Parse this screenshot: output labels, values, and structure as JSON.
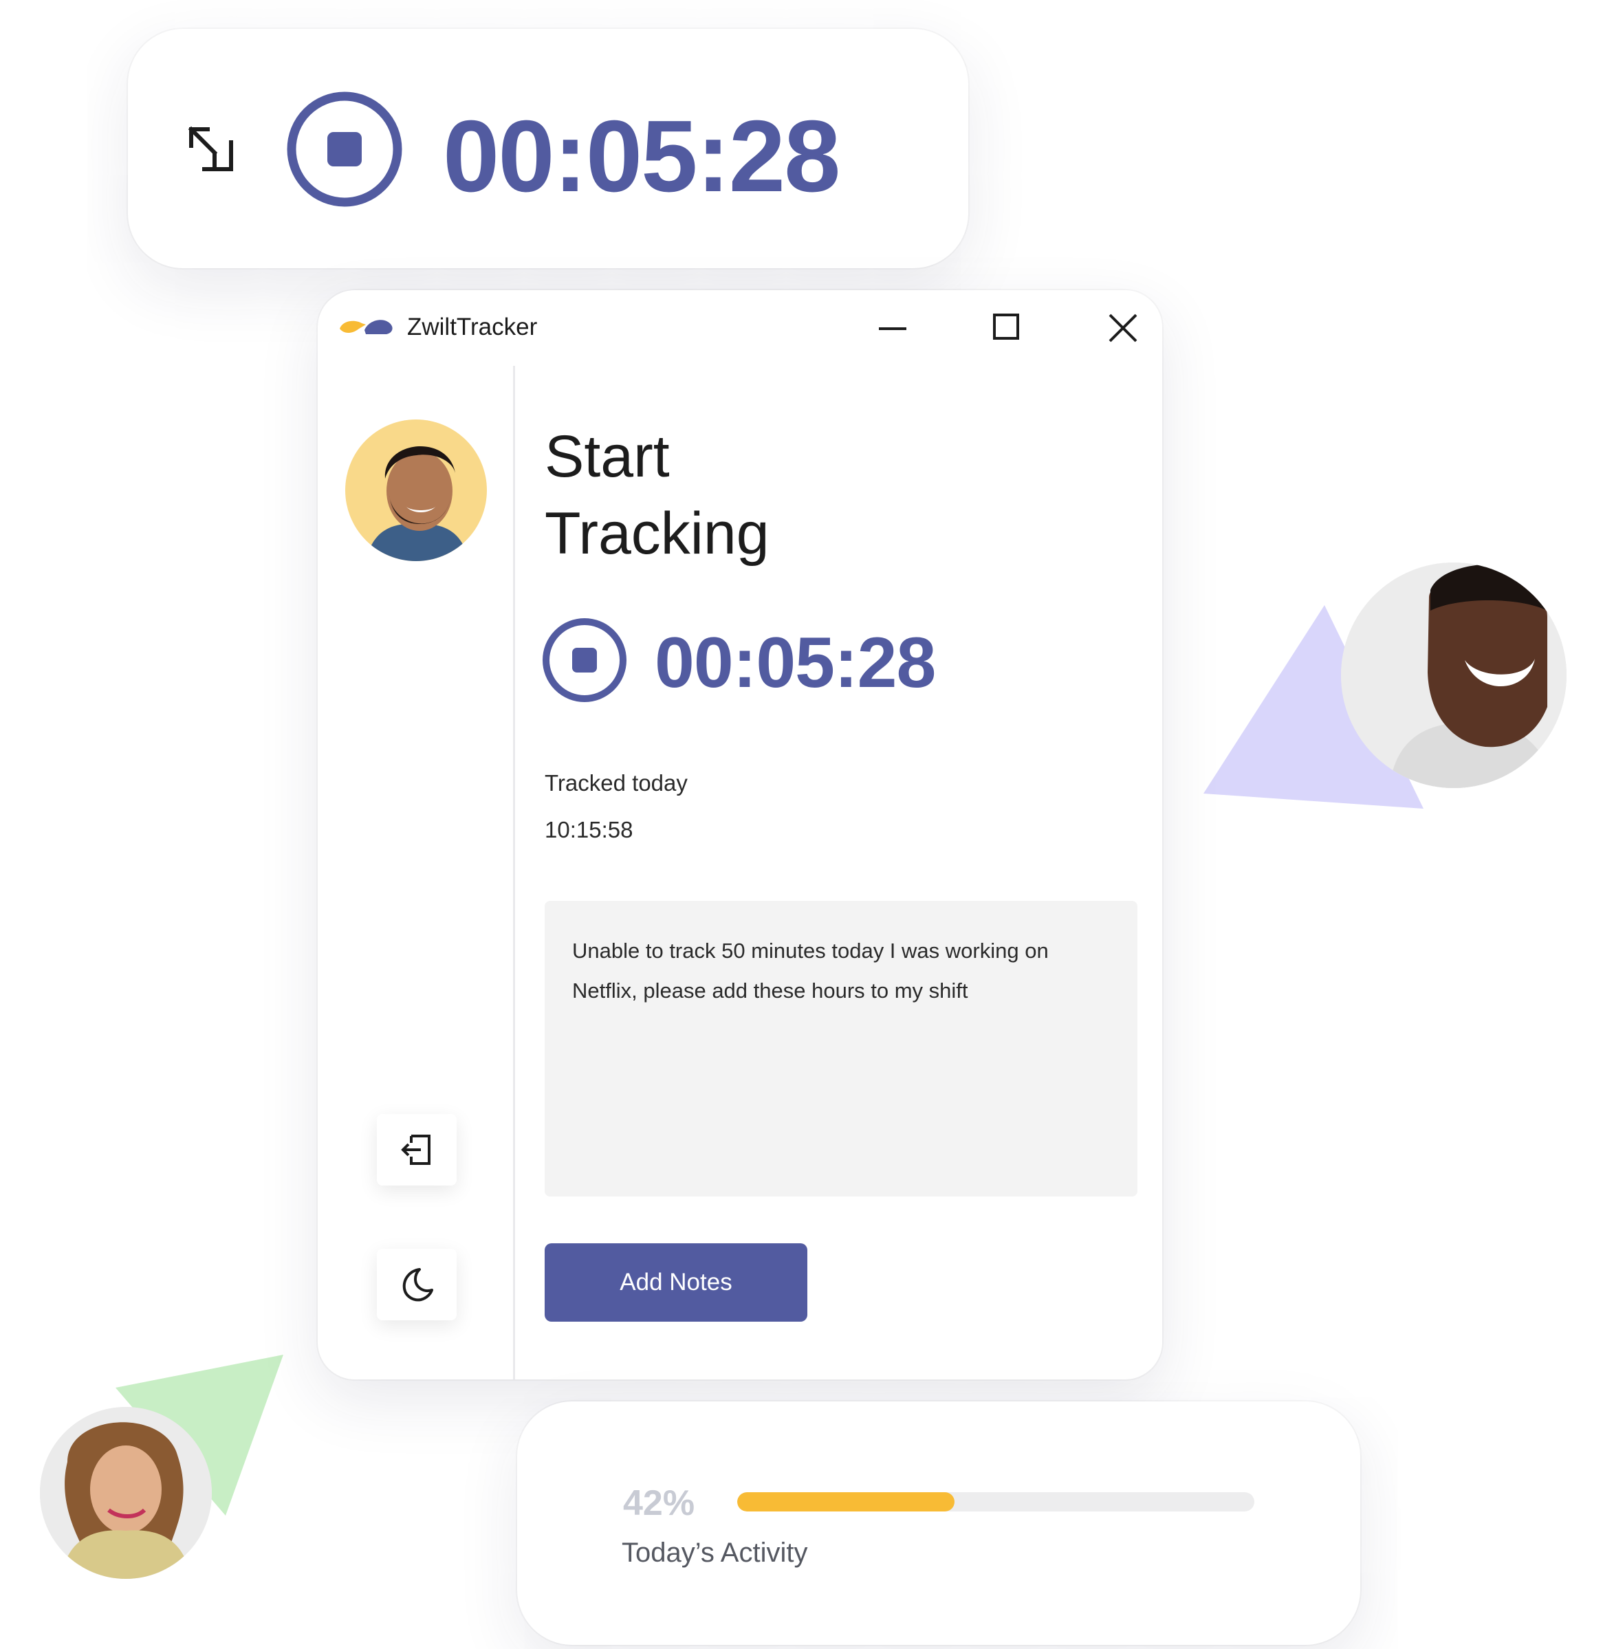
{
  "mini_timer": {
    "time": "00:05:28",
    "expand_icon": "expand-icon",
    "stop_icon": "stop-icon"
  },
  "window": {
    "app_name": "ZwiltTracker",
    "logo": "zwilt-logo",
    "controls": [
      "minimize-icon",
      "maximize-icon",
      "close-icon"
    ]
  },
  "sidebar": {
    "avatar": "user-avatar",
    "buttons": [
      {
        "icon": "logout-icon"
      },
      {
        "icon": "moon-icon"
      }
    ]
  },
  "main": {
    "heading_line1": "Start",
    "heading_line2": "Tracking",
    "timer": "00:05:28",
    "tracked_label": "Tracked today",
    "tracked_value": "10:15:58",
    "notes_text": "Unable to track 50 minutes today I was working on Netflix, please add these hours to my shift",
    "add_notes_label": "Add Notes"
  },
  "activity": {
    "percent_label": "42%",
    "percent_value": 0.42,
    "label": "Today’s Activity"
  },
  "colors": {
    "accent": "#525ba0",
    "progress": "#f8bb35",
    "avatar_bg": "#f9d98a",
    "triangle_purple": "#d9d6fb",
    "triangle_green": "#c8eec5"
  }
}
